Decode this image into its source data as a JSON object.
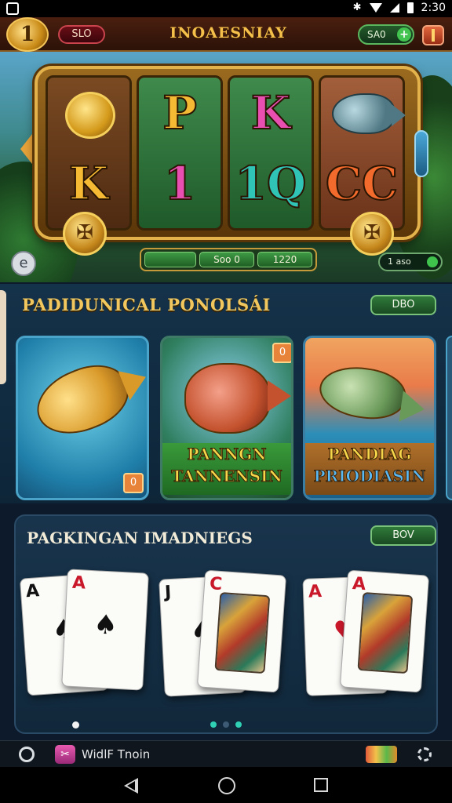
{
  "status_bar": {
    "time": "2:30",
    "icons": [
      "notification-icon",
      "bluetooth-icon",
      "wifi-icon",
      "signal-icon",
      "battery-icon"
    ]
  },
  "top_bar": {
    "slo_button": "SLO",
    "title": "INOAESNIAY",
    "coins": "SA0",
    "plus": "+",
    "logo_glyph": "1"
  },
  "slot_machine": {
    "reels": [
      {
        "top": "coins",
        "bottom": "K"
      },
      {
        "top": "P",
        "bottom": "1"
      },
      {
        "top": "K",
        "bottom": "1Q"
      },
      {
        "top": "fish",
        "bottom": "CC"
      }
    ],
    "bet_segments": [
      "",
      "Soo 0",
      "1220"
    ],
    "spin_glyph": "e",
    "balance": "1 aso",
    "medal_glyph": "✠"
  },
  "section_fishing": {
    "title": "PADIDUNICAL PONOLSÁI",
    "button": "DBO",
    "badge_1": "0",
    "badge_2": "0",
    "cards": [
      {
        "name": "golden-fish-game"
      },
      {
        "line1": "PANNGN",
        "line2": "TANNENSIN"
      },
      {
        "line1": "PANDIAG",
        "line2": "PRIODIASIN"
      }
    ]
  },
  "section_cards": {
    "title": "PAGKINGAN IMADNIEGS",
    "button": "BOV",
    "cards": [
      {
        "rank": "A",
        "suit": "♠",
        "color": "black"
      },
      {
        "rank": "A",
        "suit": "♠",
        "color": "red"
      },
      {
        "rank": "J",
        "suit": "♠",
        "color": "black"
      },
      {
        "rank": "C",
        "suit": "♦",
        "color": "red"
      },
      {
        "rank": "A",
        "suit": "♥",
        "color": "red"
      },
      {
        "rank": "A",
        "suit": "♦",
        "color": "red"
      }
    ]
  },
  "bottom_bar": {
    "app_icon_glyph": "✂",
    "label": "WidlF Tnoin"
  },
  "colors": {
    "accent_gold": "#f4c04a",
    "button_green": "#2f7a3a",
    "background_navy": "#0e2538"
  }
}
